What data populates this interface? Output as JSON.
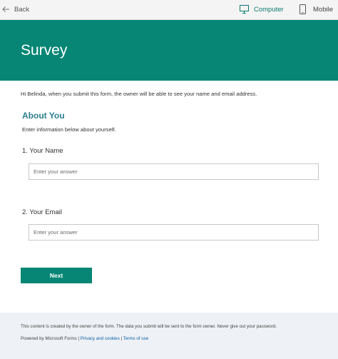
{
  "topbar": {
    "back_label": "Back",
    "computer_label": "Computer",
    "mobile_label": "Mobile"
  },
  "form": {
    "title": "Survey",
    "intro": "Hi Belinda, when you submit this form, the owner will be able to see your name and email address.",
    "section_title": "About You",
    "section_description": "Enter information below about yourself.",
    "questions": [
      {
        "label": "1. Your Name",
        "placeholder": "Enter your answer",
        "value": ""
      },
      {
        "label": "2. Your Email",
        "placeholder": "Enter your answer",
        "value": ""
      }
    ],
    "next_label": "Next"
  },
  "footer": {
    "note": "This content is created by the owner of the form. The data you submit will be sent to the form owner. Never give out your password.",
    "powered_by": "Powered by Microsoft Forms",
    "separator": " | ",
    "privacy_link": "Privacy and cookies",
    "terms_link": "Terms of use"
  },
  "colors": {
    "accent": "#078675",
    "section_title": "#2b7e8f",
    "link": "#0b5fa5",
    "page_background": "#eef1f5"
  },
  "icons": {
    "back": "back-arrow-icon",
    "computer": "monitor-icon",
    "mobile": "phone-icon"
  }
}
